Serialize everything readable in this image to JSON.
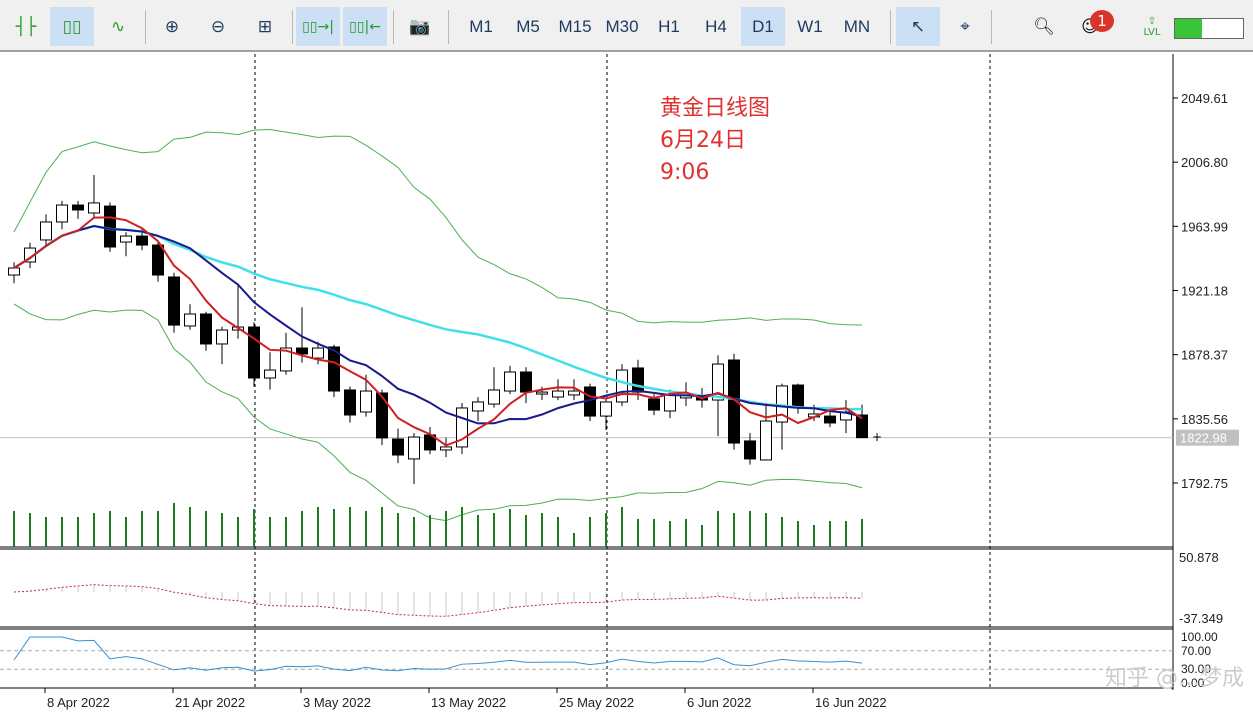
{
  "toolbar": {
    "chart_types": [
      {
        "icon": "bar-chart-icon",
        "active": false
      },
      {
        "icon": "candlestick-icon",
        "active": true
      },
      {
        "icon": "line-chart-icon",
        "active": false
      }
    ],
    "tools": [
      "zoom-in-icon",
      "zoom-out-icon",
      "grid-icon",
      "autoscroll-icon",
      "chart-shift-icon",
      "screenshot-icon"
    ],
    "timeframes": [
      {
        "label": "M1"
      },
      {
        "label": "M5"
      },
      {
        "label": "M15"
      },
      {
        "label": "M30"
      },
      {
        "label": "H1"
      },
      {
        "label": "H4"
      },
      {
        "label": "D1",
        "active": true
      },
      {
        "label": "W1"
      },
      {
        "label": "MN"
      }
    ],
    "notification_count": "1",
    "level_label": "LVL",
    "level_progress": 0.4
  },
  "annotation": {
    "line1": "黄金日线图",
    "line2": "6月24日",
    "line3": "9:06"
  },
  "watermark": "知乎 @…梦成",
  "chart_data": {
    "type": "candlestick",
    "current_price": "1822.98",
    "price_ticks": [
      "2049.61",
      "2006.80",
      "1963.99",
      "1921.18",
      "1878.37",
      "1835.56",
      "1792.75"
    ],
    "date_labels": [
      {
        "i": 2,
        "label": "8 Apr 2022"
      },
      {
        "i": 10,
        "label": "21 Apr 2022"
      },
      {
        "i": 18,
        "label": "3 May 2022"
      },
      {
        "i": 26,
        "label": "13 May 2022"
      },
      {
        "i": 34,
        "label": "25 May 2022"
      },
      {
        "i": 42,
        "label": "6 Jun 2022"
      },
      {
        "i": 50,
        "label": "16 Jun 2022"
      }
    ],
    "ohlc": [
      [
        1931.5,
        1940,
        1926,
        1936.2
      ],
      [
        1940.2,
        1953,
        1936,
        1949.5
      ],
      [
        1954.9,
        1972,
        1950,
        1966.9
      ],
      [
        1966.9,
        1981,
        1962,
        1978.2
      ],
      [
        1978.2,
        1981,
        1969,
        1974.9
      ],
      [
        1972.9,
        1998.2,
        1970,
        1979.6
      ],
      [
        1977.5,
        1980,
        1947,
        1950.2
      ],
      [
        1953.5,
        1960,
        1944,
        1957.5
      ],
      [
        1957.5,
        1962,
        1948,
        1951.5
      ],
      [
        1951.5,
        1954,
        1927,
        1931.5
      ],
      [
        1930.2,
        1933,
        1893,
        1898.1
      ],
      [
        1897.5,
        1912,
        1895,
        1905.5
      ],
      [
        1905.5,
        1907,
        1881,
        1885.5
      ],
      [
        1885.5,
        1897,
        1872,
        1894.8
      ],
      [
        1894.8,
        1925,
        1889,
        1896.8
      ],
      [
        1896.8,
        1900,
        1857,
        1862.8
      ],
      [
        1862.8,
        1880,
        1855,
        1868.1
      ],
      [
        1867.5,
        1893,
        1865,
        1882.8
      ],
      [
        1882.8,
        1910,
        1873,
        1878.8
      ],
      [
        1876.1,
        1887,
        1872,
        1882.8
      ],
      [
        1883.5,
        1885,
        1850,
        1854.1
      ],
      [
        1854.8,
        1857,
        1833,
        1838.1
      ],
      [
        1840.1,
        1865,
        1837,
        1854.1
      ],
      [
        1852.8,
        1855,
        1818,
        1822.8
      ],
      [
        1822.1,
        1829,
        1806,
        1811.4
      ],
      [
        1808.8,
        1826,
        1792,
        1823.4
      ],
      [
        1824.8,
        1830,
        1812,
        1814.8
      ],
      [
        1814.8,
        1823,
        1810,
        1816.8
      ],
      [
        1816.8,
        1846,
        1812,
        1842.8
      ],
      [
        1840.8,
        1850,
        1834,
        1846.8
      ],
      [
        1845.4,
        1870,
        1843,
        1854.8
      ],
      [
        1854.1,
        1871,
        1852,
        1866.8
      ],
      [
        1866.8,
        1870,
        1846,
        1853.4
      ],
      [
        1852.1,
        1857,
        1848,
        1853.4
      ],
      [
        1850.1,
        1862,
        1848,
        1854.1
      ],
      [
        1851.5,
        1862,
        1848,
        1854.1
      ],
      [
        1856.8,
        1859,
        1834,
        1837.4
      ],
      [
        1837.4,
        1849,
        1828,
        1846.8
      ],
      [
        1846.8,
        1872,
        1844,
        1868.1
      ],
      [
        1869.5,
        1875,
        1848,
        1853.4
      ],
      [
        1848.8,
        1852,
        1838,
        1841.4
      ],
      [
        1840.8,
        1855,
        1836,
        1851.5
      ],
      [
        1849.5,
        1860,
        1844,
        1851.5
      ],
      [
        1850.1,
        1856,
        1843,
        1848.1
      ],
      [
        1848.1,
        1878,
        1824,
        1872.1
      ],
      [
        1874.8,
        1879,
        1815,
        1819.4
      ],
      [
        1820.8,
        1826,
        1805,
        1808.8
      ],
      [
        1808.1,
        1846,
        1808,
        1834.1
      ],
      [
        1833.4,
        1859,
        1815,
        1857.5
      ],
      [
        1858.1,
        1859,
        1839,
        1844.1
      ],
      [
        1836.8,
        1845,
        1834,
        1838.8
      ],
      [
        1837.4,
        1841,
        1830,
        1832.8
      ],
      [
        1834.8,
        1848,
        1826,
        1840.1
      ],
      [
        1838.1,
        1845,
        1823,
        1822.98
      ]
    ],
    "volume": [
      36,
      34,
      30,
      30,
      30,
      34,
      36,
      30,
      36,
      36,
      44,
      40,
      36,
      34,
      30,
      38,
      30,
      30,
      36,
      40,
      38,
      40,
      36,
      40,
      34,
      30,
      32,
      36,
      40,
      32,
      34,
      38,
      32,
      34,
      30,
      14,
      30,
      34,
      40,
      28,
      28,
      26,
      28,
      22,
      36,
      34,
      36,
      34,
      30,
      26,
      22,
      26,
      26,
      28
    ],
    "osc1_ticks": [
      "50.878",
      "-37.349"
    ],
    "osc2_ticks": [
      "100.00",
      "70.00",
      "30.00",
      "0.00"
    ],
    "colors": {
      "bull": "#ffffff",
      "bear": "#000000",
      "ma_fast": "#d02020",
      "ma_mid": "#1a1a8c",
      "ma_slow": "#40e0e8",
      "bands": "#4caf50",
      "volume": "#1f7a1f",
      "osc1": "#c03030",
      "osc2": "#3a8fd0"
    }
  }
}
